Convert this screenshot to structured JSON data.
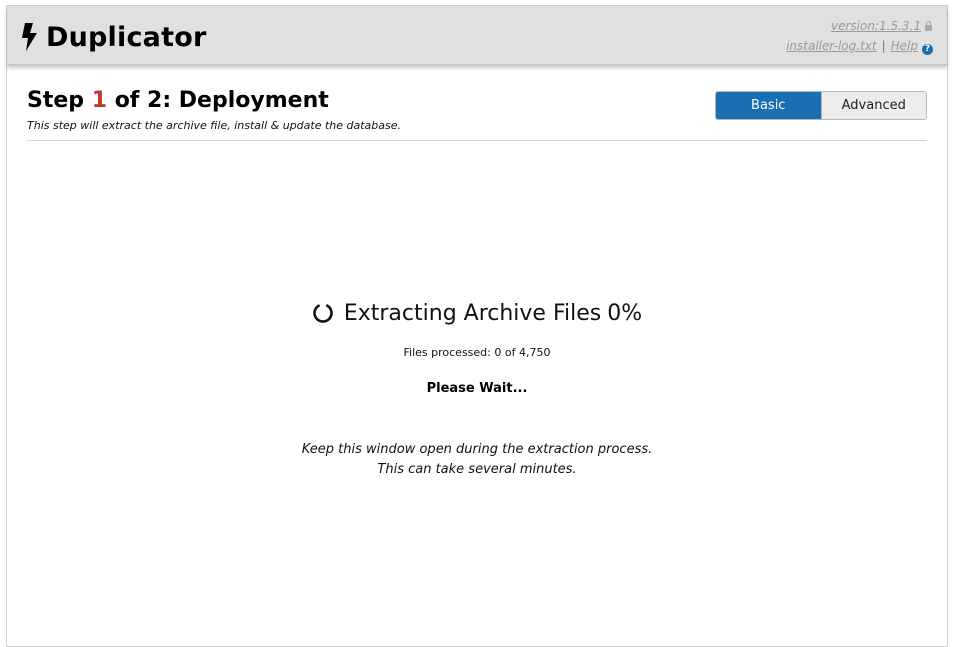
{
  "header": {
    "brand": "Duplicator",
    "version_link": "version:1.5.3.1",
    "log_link": "installer-log.txt",
    "separator": "|",
    "help_link": "Help",
    "help_glyph": "?"
  },
  "step": {
    "prefix": "Step",
    "number": "1",
    "suffix": "of 2: Deployment",
    "subtitle": "This step will extract the archive file, install & update the database."
  },
  "modes": {
    "basic_label": "Basic",
    "advanced_label": "Advanced",
    "active": "Basic"
  },
  "progress": {
    "title": "Extracting Archive Files",
    "percent_text": "0%",
    "percent": 0,
    "files_label": "Files processed:",
    "files_processed": "0",
    "files_of": "of",
    "files_total": "4,750",
    "wait_text": "Please Wait...",
    "note_line1": "Keep this window open during the extraction process.",
    "note_line2": "This can take several minutes."
  },
  "colors": {
    "accent": "#1a6fb3",
    "step_number": "#c0392b",
    "header_bg": "#e0e0e0",
    "muted_link": "#9a9a9a"
  },
  "icons": {
    "logo": "bolt-icon",
    "lock": "lock-icon",
    "help": "help-icon",
    "spinner": "spinner-icon"
  }
}
